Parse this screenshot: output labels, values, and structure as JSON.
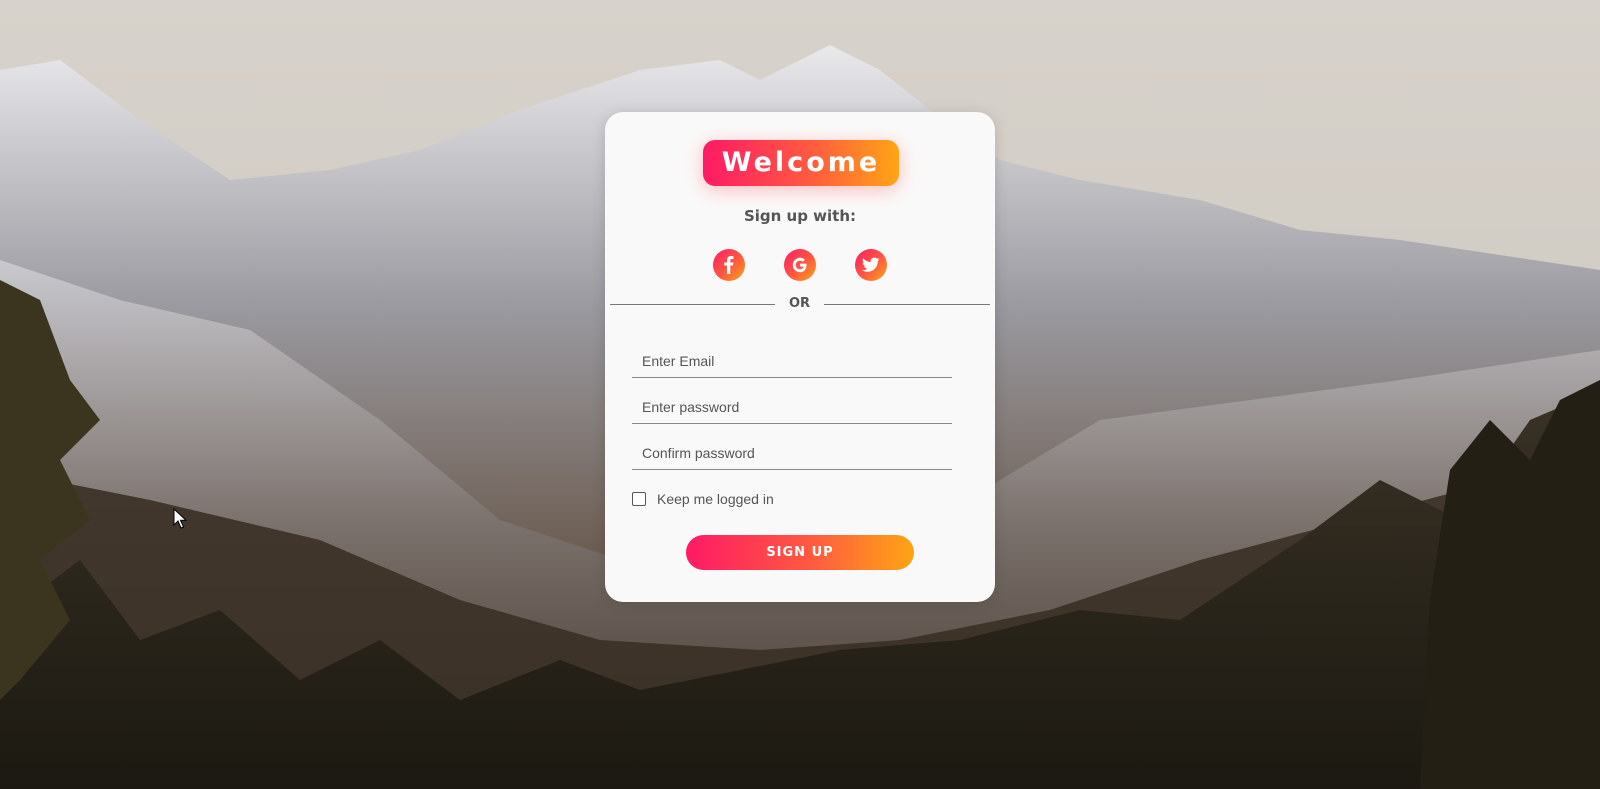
{
  "header": {
    "title": "Welcome"
  },
  "social": {
    "heading": "Sign up with:",
    "icons": [
      "facebook-icon",
      "google-icon",
      "twitter-icon"
    ]
  },
  "divider": {
    "text": "OR"
  },
  "form": {
    "email_placeholder": "Enter Email",
    "password_placeholder": "Enter password",
    "confirm_placeholder": "Confirm password",
    "remember_label": "Keep me logged in",
    "submit_label": "SIGN UP"
  },
  "colors": {
    "gradient_start": "#ff1a66",
    "gradient_end": "#ffa514",
    "card_bg": "#faf9f9"
  }
}
